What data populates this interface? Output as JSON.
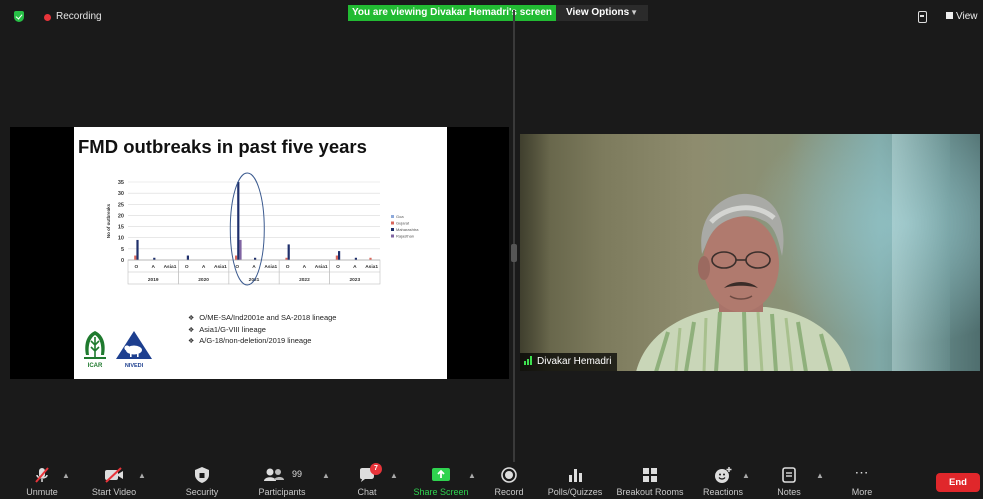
{
  "top": {
    "recording_label": "Recording",
    "banner_text": "You are viewing Divakar Hemadri's screen",
    "view_options_label": "View Options",
    "view_label": "View"
  },
  "slide": {
    "title": "FMD outbreaks in past five years",
    "bullets": [
      "O/ME-SA/Ind2001e and SA-2018 lineage",
      "Asia1/G-VIII lineage",
      "A/G-18/non-deletion/2019 lineage"
    ],
    "logo_text_left": "ICAR",
    "logo_text_right": "NIVEDI"
  },
  "chart_data": {
    "type": "bar",
    "ylabel": "No of outbreaks",
    "ylim": [
      0,
      35
    ],
    "yticks": [
      0,
      5,
      10,
      15,
      20,
      25,
      30,
      35
    ],
    "years": [
      "2019",
      "2020",
      "2021",
      "2022",
      "2023"
    ],
    "serotypes": [
      "O",
      "A",
      "Asia1"
    ],
    "categories": [
      "O",
      "A",
      "Asia1",
      "O",
      "A",
      "Asia1",
      "O",
      "A",
      "Asia1",
      "O",
      "A",
      "Asia1",
      "O",
      "A",
      "Asia1"
    ],
    "series": [
      {
        "name": "Goa",
        "color": "#8eaadb",
        "values": [
          0,
          0,
          0,
          0,
          0,
          0,
          0,
          0,
          0,
          0,
          0,
          0,
          0,
          0,
          0
        ]
      },
      {
        "name": "Gujarat",
        "color": "#d9675c",
        "values": [
          2,
          0,
          0,
          0,
          0,
          0,
          2,
          0,
          0,
          1,
          0,
          0,
          2,
          0,
          1
        ]
      },
      {
        "name": "Maharashtra",
        "color": "#1f2f6b",
        "values": [
          9,
          1,
          0,
          2,
          0,
          0,
          35,
          1,
          0,
          7,
          0,
          0,
          4,
          1,
          0
        ]
      },
      {
        "name": "Rajasthan",
        "color": "#8064a2",
        "values": [
          0,
          0,
          0,
          0,
          0,
          0,
          9,
          0,
          0,
          0,
          0,
          0,
          0,
          0,
          0
        ]
      }
    ],
    "highlight_year": "2021",
    "legend_position": "right"
  },
  "camera": {
    "participant_name": "Divakar Hemadri"
  },
  "toolbar": {
    "unmute": "Unmute",
    "start_video": "Start Video",
    "security": "Security",
    "participants": "Participants",
    "participants_count": "99",
    "chat": "Chat",
    "chat_badge": "7",
    "share_screen": "Share Screen",
    "record": "Record",
    "polls": "Polls/Quizzes",
    "breakout": "Breakout Rooms",
    "reactions": "Reactions",
    "notes": "Notes",
    "more": "More",
    "end": "End"
  },
  "colors": {
    "accent_green": "#22bb33",
    "end_red": "#e0272b",
    "background": "#1a1a1a"
  }
}
